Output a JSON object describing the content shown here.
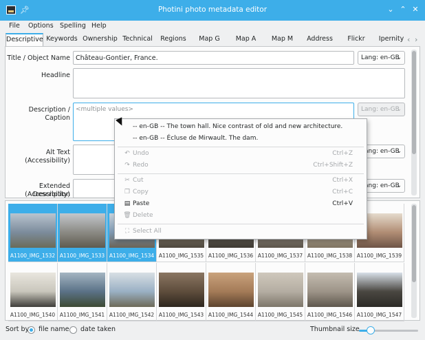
{
  "window": {
    "title": "Photini photo metadata editor"
  },
  "titlebar_buttons": {
    "minimize": "⌄",
    "maximize": "⌃",
    "close": "✕"
  },
  "menu": [
    "File",
    "Options",
    "Spelling",
    "Help"
  ],
  "tabs": [
    "Descriptive",
    "Keywords",
    "Ownership",
    "Technical",
    "Regions",
    "Map G",
    "Map A",
    "Map M",
    "Address",
    "Flickr",
    "Ipernity"
  ],
  "tab_arrows": {
    "left": "‹",
    "right": "›"
  },
  "fields": {
    "title_label": "Title / Object Name",
    "title_value": "Château-Gontier, France.",
    "title_lang": "Lang: en-GB",
    "headline_label": "Headline",
    "description_label": "Description / Caption",
    "description_placeholder": "<multiple values>",
    "description_lang": "Lang: en-GB",
    "alt_text_label_1": "Alt Text",
    "alt_text_label_2": "(Accessibility)",
    "alt_text_lang": "Lang: en-GB",
    "extended_label_1": "Extended Description",
    "extended_label_2": "(Accessibility)",
    "extended_lang": "Lang: en-GB"
  },
  "context_menu": {
    "options": [
      "-- en-GB -- The town hall. Nice contrast of old and new architecture.",
      "-- en-GB -- Écluse de Mirwault. The dam."
    ],
    "undo": "Undo",
    "undo_shortcut": "Ctrl+Z",
    "redo": "Redo",
    "redo_shortcut": "Ctrl+Shift+Z",
    "cut": "Cut",
    "cut_shortcut": "Ctrl+X",
    "copy": "Copy",
    "copy_shortcut": "Ctrl+C",
    "paste": "Paste",
    "paste_shortcut": "Ctrl+V",
    "delete": "Delete",
    "select_all": "Select All",
    "icons": {
      "undo": "undo-icon",
      "redo": "redo-icon",
      "cut": "cut-icon",
      "copy": "copy-icon",
      "paste": "paste-icon",
      "delete": "delete-icon",
      "select_all": "select-all-icon"
    }
  },
  "thumbnails": [
    {
      "name": "A1100_IMG_1532",
      "selected": true
    },
    {
      "name": "A1100_IMG_1533",
      "selected": true
    },
    {
      "name": "A1100_IMG_1534",
      "selected": true
    },
    {
      "name": "A1100_IMG_1535",
      "selected": false
    },
    {
      "name": "A1100_IMG_1536",
      "selected": false
    },
    {
      "name": "A1100_IMG_1537",
      "selected": false
    },
    {
      "name": "A1100_IMG_1538",
      "selected": false
    },
    {
      "name": "A1100_IMG_1539",
      "selected": false
    },
    {
      "name": "A1100_IMG_1540",
      "selected": false
    },
    {
      "name": "A1100_IMG_1541",
      "selected": false
    },
    {
      "name": "A1100_IMG_1542",
      "selected": false
    },
    {
      "name": "A1100_IMG_1543",
      "selected": false
    },
    {
      "name": "A1100_IMG_1544",
      "selected": false
    },
    {
      "name": "A1100_IMG_1545",
      "selected": false
    },
    {
      "name": "A1100_IMG_1546",
      "selected": false
    },
    {
      "name": "A1100_IMG_1547",
      "selected": false
    }
  ],
  "bottom": {
    "sort_by": "Sort by",
    "file_name": "file name",
    "date_taken": "date taken",
    "sort_selected": "file name",
    "thumbnail_size": "Thumbnail size",
    "thumbnail_size_level": 0.2
  },
  "colors": {
    "accent": "#3daee9",
    "selection": "#3daee9"
  }
}
